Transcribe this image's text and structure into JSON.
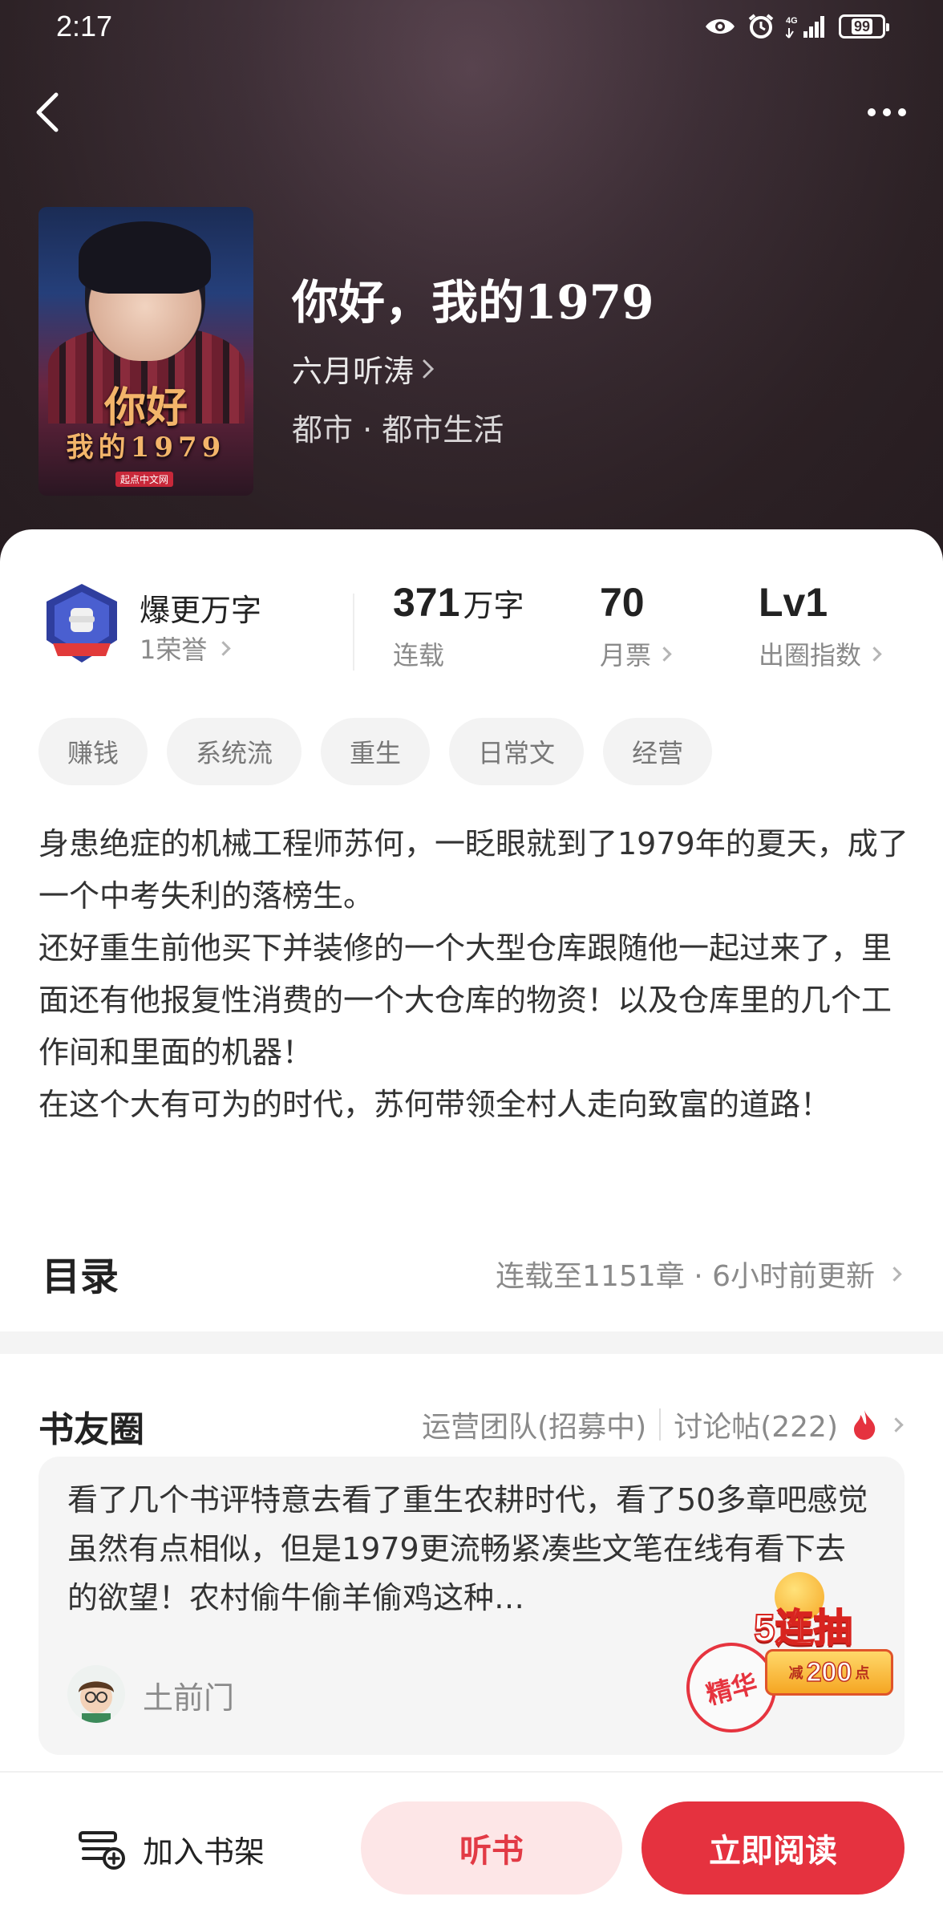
{
  "status_bar": {
    "time": "2:17",
    "battery": "99"
  },
  "book": {
    "title": "你好，我的1979",
    "author": "六月听涛",
    "genre": "都市 · 都市生活",
    "cover": {
      "title_line1": "你好",
      "title_line2": "我的1979",
      "publisher": "起点中文网"
    }
  },
  "honor": {
    "title": "爆更万字",
    "sub": "1荣誉"
  },
  "stats": [
    {
      "value": "371",
      "unit": "万字",
      "label": "连载"
    },
    {
      "value": "70",
      "unit": "",
      "label": "月票"
    },
    {
      "value": "Lv1",
      "unit": "",
      "label": "出圈指数"
    }
  ],
  "tags": [
    "赚钱",
    "系统流",
    "重生",
    "日常文",
    "经营"
  ],
  "description": "身患绝症的机械工程师苏何，一眨眼就到了1979年的夏天，成了一个中考失利的落榜生。\n还好重生前他买下并装修的一个大型仓库跟随他一起过来了，里面还有他报复性消费的一个大仓库的物资！以及仓库里的几个工作间和里面的机器！\n在这个大有可为的时代，苏何带领全村人走向致富的道路！",
  "toc": {
    "title": "目录",
    "info": "连载至1151章 · 6小时前更新"
  },
  "circle": {
    "title": "书友圈",
    "link_team": "运营团队(招募中)",
    "link_posts": "讨论帖(222)",
    "post": {
      "text": "看了几个书评特意去看了重生农耕时代，看了50多章吧感觉虽然有点相似，但是1979更流畅紧凑些文笔在线有看下去的欲望！农村偷牛偷羊偷鸡这种…",
      "user": "土前门",
      "stamp": "精华"
    }
  },
  "promo": {
    "headline": "5连抽",
    "prefix": "减",
    "amount": "200",
    "suffix": "点"
  },
  "bottom": {
    "shelf": "加入书架",
    "listen": "听书",
    "read": "立即阅读"
  },
  "colors": {
    "accent": "#e5323f",
    "accent_soft": "#fde6e7",
    "hero_bg": "#3a2c31"
  }
}
